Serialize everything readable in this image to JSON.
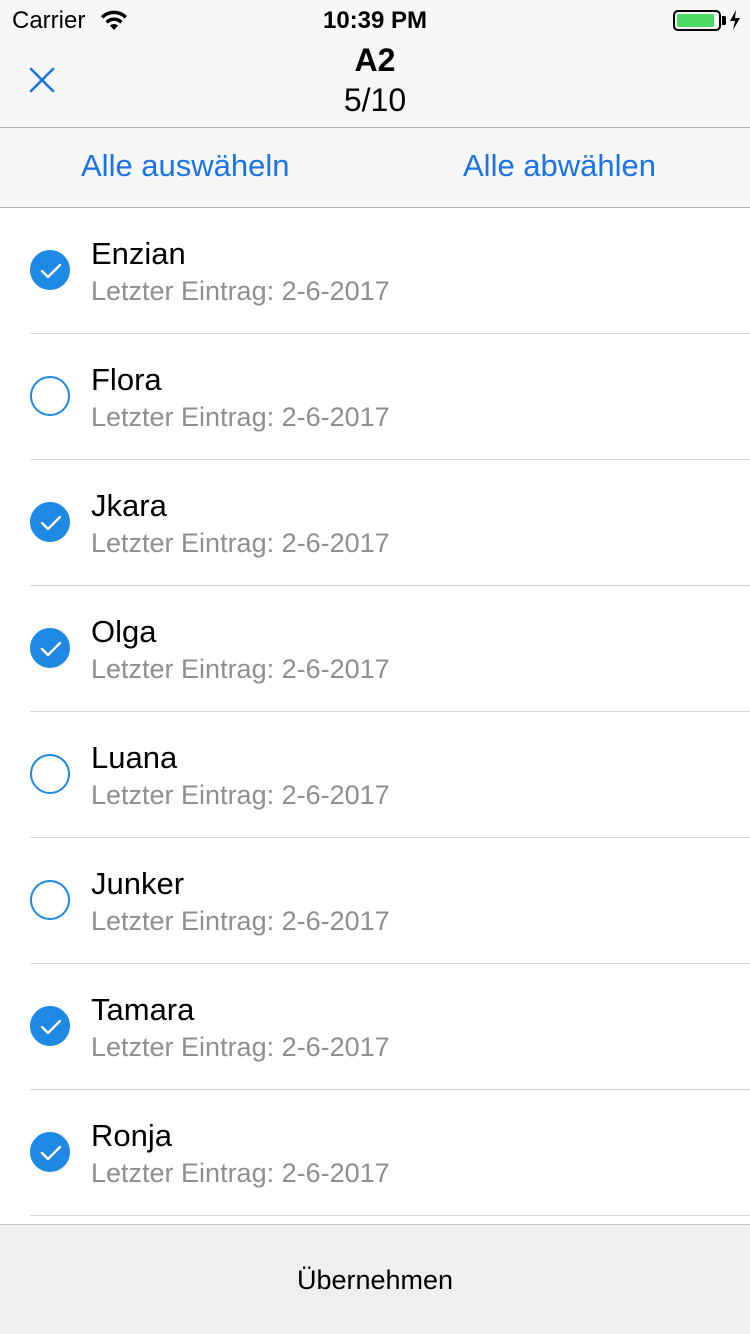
{
  "status_bar": {
    "carrier": "Carrier",
    "time": "10:39 PM",
    "battery_level": 0.92,
    "battery_color": "#4cd964"
  },
  "nav": {
    "title": "A2",
    "subtitle": "5/10",
    "close_icon": "close-icon"
  },
  "selection": {
    "select_all": "Alle auswäheln",
    "deselect_all": "Alle abwählen"
  },
  "items": [
    {
      "name": "Enzian",
      "subtitle": "Letzter Eintrag: 2-6-2017",
      "checked": true
    },
    {
      "name": "Flora",
      "subtitle": "Letzter Eintrag: 2-6-2017",
      "checked": false
    },
    {
      "name": "Jkara",
      "subtitle": "Letzter Eintrag: 2-6-2017",
      "checked": true
    },
    {
      "name": "Olga",
      "subtitle": "Letzter Eintrag: 2-6-2017",
      "checked": true
    },
    {
      "name": "Luana",
      "subtitle": "Letzter Eintrag: 2-6-2017",
      "checked": false
    },
    {
      "name": "Junker",
      "subtitle": "Letzter Eintrag: 2-6-2017",
      "checked": false
    },
    {
      "name": "Tamara",
      "subtitle": "Letzter Eintrag: 2-6-2017",
      "checked": true
    },
    {
      "name": "Ronja",
      "subtitle": "Letzter Eintrag: 2-6-2017",
      "checked": true
    }
  ],
  "footer": {
    "apply_label": "Übernehmen"
  },
  "colors": {
    "accent": "#1e88e5",
    "link": "#1a73e8"
  }
}
